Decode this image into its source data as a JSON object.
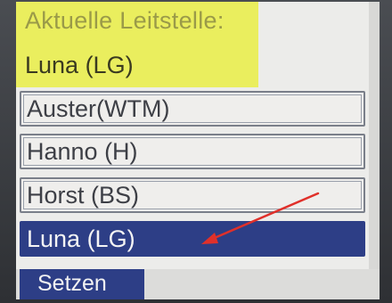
{
  "header": {
    "label": "Aktuelle Leitstelle:",
    "current_value": "Luna (LG)",
    "background_color": "#eaee5e"
  },
  "list": {
    "items": [
      {
        "label": "Auster(WTM)",
        "selected": false
      },
      {
        "label": "Hanno (H)",
        "selected": false
      },
      {
        "label": "Horst (BS)",
        "selected": false
      },
      {
        "label": "Luna (LG)",
        "selected": true
      }
    ],
    "selection_color": "#2d3e86"
  },
  "softkeys": {
    "set_label": "Setzen"
  },
  "annotation": {
    "arrow_color": "#e0302a",
    "arrow_icon": "red-arrow-icon"
  }
}
